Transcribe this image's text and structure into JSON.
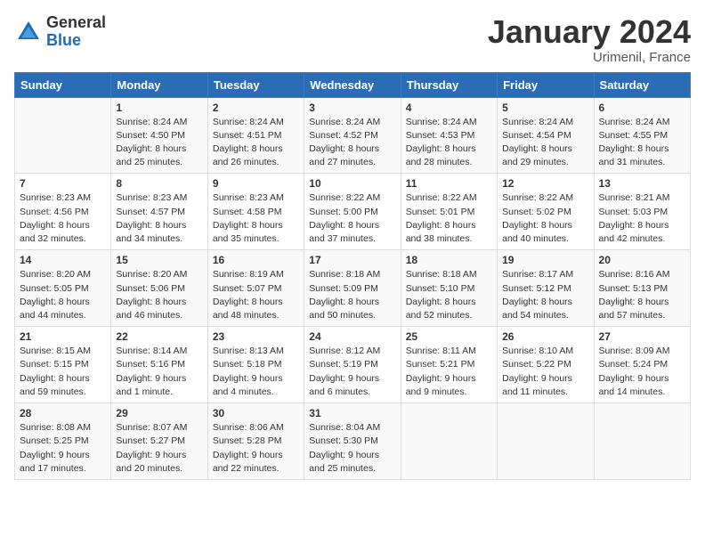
{
  "logo": {
    "general": "General",
    "blue": "Blue"
  },
  "title": "January 2024",
  "location": "Urimenil, France",
  "days_header": [
    "Sunday",
    "Monday",
    "Tuesday",
    "Wednesday",
    "Thursday",
    "Friday",
    "Saturday"
  ],
  "weeks": [
    [
      {
        "day": "",
        "sunrise": "",
        "sunset": "",
        "daylight": ""
      },
      {
        "day": "1",
        "sunrise": "Sunrise: 8:24 AM",
        "sunset": "Sunset: 4:50 PM",
        "daylight": "Daylight: 8 hours and 25 minutes."
      },
      {
        "day": "2",
        "sunrise": "Sunrise: 8:24 AM",
        "sunset": "Sunset: 4:51 PM",
        "daylight": "Daylight: 8 hours and 26 minutes."
      },
      {
        "day": "3",
        "sunrise": "Sunrise: 8:24 AM",
        "sunset": "Sunset: 4:52 PM",
        "daylight": "Daylight: 8 hours and 27 minutes."
      },
      {
        "day": "4",
        "sunrise": "Sunrise: 8:24 AM",
        "sunset": "Sunset: 4:53 PM",
        "daylight": "Daylight: 8 hours and 28 minutes."
      },
      {
        "day": "5",
        "sunrise": "Sunrise: 8:24 AM",
        "sunset": "Sunset: 4:54 PM",
        "daylight": "Daylight: 8 hours and 29 minutes."
      },
      {
        "day": "6",
        "sunrise": "Sunrise: 8:24 AM",
        "sunset": "Sunset: 4:55 PM",
        "daylight": "Daylight: 8 hours and 31 minutes."
      }
    ],
    [
      {
        "day": "7",
        "sunrise": "Sunrise: 8:23 AM",
        "sunset": "Sunset: 4:56 PM",
        "daylight": "Daylight: 8 hours and 32 minutes."
      },
      {
        "day": "8",
        "sunrise": "Sunrise: 8:23 AM",
        "sunset": "Sunset: 4:57 PM",
        "daylight": "Daylight: 8 hours and 34 minutes."
      },
      {
        "day": "9",
        "sunrise": "Sunrise: 8:23 AM",
        "sunset": "Sunset: 4:58 PM",
        "daylight": "Daylight: 8 hours and 35 minutes."
      },
      {
        "day": "10",
        "sunrise": "Sunrise: 8:22 AM",
        "sunset": "Sunset: 5:00 PM",
        "daylight": "Daylight: 8 hours and 37 minutes."
      },
      {
        "day": "11",
        "sunrise": "Sunrise: 8:22 AM",
        "sunset": "Sunset: 5:01 PM",
        "daylight": "Daylight: 8 hours and 38 minutes."
      },
      {
        "day": "12",
        "sunrise": "Sunrise: 8:22 AM",
        "sunset": "Sunset: 5:02 PM",
        "daylight": "Daylight: 8 hours and 40 minutes."
      },
      {
        "day": "13",
        "sunrise": "Sunrise: 8:21 AM",
        "sunset": "Sunset: 5:03 PM",
        "daylight": "Daylight: 8 hours and 42 minutes."
      }
    ],
    [
      {
        "day": "14",
        "sunrise": "Sunrise: 8:20 AM",
        "sunset": "Sunset: 5:05 PM",
        "daylight": "Daylight: 8 hours and 44 minutes."
      },
      {
        "day": "15",
        "sunrise": "Sunrise: 8:20 AM",
        "sunset": "Sunset: 5:06 PM",
        "daylight": "Daylight: 8 hours and 46 minutes."
      },
      {
        "day": "16",
        "sunrise": "Sunrise: 8:19 AM",
        "sunset": "Sunset: 5:07 PM",
        "daylight": "Daylight: 8 hours and 48 minutes."
      },
      {
        "day": "17",
        "sunrise": "Sunrise: 8:18 AM",
        "sunset": "Sunset: 5:09 PM",
        "daylight": "Daylight: 8 hours and 50 minutes."
      },
      {
        "day": "18",
        "sunrise": "Sunrise: 8:18 AM",
        "sunset": "Sunset: 5:10 PM",
        "daylight": "Daylight: 8 hours and 52 minutes."
      },
      {
        "day": "19",
        "sunrise": "Sunrise: 8:17 AM",
        "sunset": "Sunset: 5:12 PM",
        "daylight": "Daylight: 8 hours and 54 minutes."
      },
      {
        "day": "20",
        "sunrise": "Sunrise: 8:16 AM",
        "sunset": "Sunset: 5:13 PM",
        "daylight": "Daylight: 8 hours and 57 minutes."
      }
    ],
    [
      {
        "day": "21",
        "sunrise": "Sunrise: 8:15 AM",
        "sunset": "Sunset: 5:15 PM",
        "daylight": "Daylight: 8 hours and 59 minutes."
      },
      {
        "day": "22",
        "sunrise": "Sunrise: 8:14 AM",
        "sunset": "Sunset: 5:16 PM",
        "daylight": "Daylight: 9 hours and 1 minute."
      },
      {
        "day": "23",
        "sunrise": "Sunrise: 8:13 AM",
        "sunset": "Sunset: 5:18 PM",
        "daylight": "Daylight: 9 hours and 4 minutes."
      },
      {
        "day": "24",
        "sunrise": "Sunrise: 8:12 AM",
        "sunset": "Sunset: 5:19 PM",
        "daylight": "Daylight: 9 hours and 6 minutes."
      },
      {
        "day": "25",
        "sunrise": "Sunrise: 8:11 AM",
        "sunset": "Sunset: 5:21 PM",
        "daylight": "Daylight: 9 hours and 9 minutes."
      },
      {
        "day": "26",
        "sunrise": "Sunrise: 8:10 AM",
        "sunset": "Sunset: 5:22 PM",
        "daylight": "Daylight: 9 hours and 11 minutes."
      },
      {
        "day": "27",
        "sunrise": "Sunrise: 8:09 AM",
        "sunset": "Sunset: 5:24 PM",
        "daylight": "Daylight: 9 hours and 14 minutes."
      }
    ],
    [
      {
        "day": "28",
        "sunrise": "Sunrise: 8:08 AM",
        "sunset": "Sunset: 5:25 PM",
        "daylight": "Daylight: 9 hours and 17 minutes."
      },
      {
        "day": "29",
        "sunrise": "Sunrise: 8:07 AM",
        "sunset": "Sunset: 5:27 PM",
        "daylight": "Daylight: 9 hours and 20 minutes."
      },
      {
        "day": "30",
        "sunrise": "Sunrise: 8:06 AM",
        "sunset": "Sunset: 5:28 PM",
        "daylight": "Daylight: 9 hours and 22 minutes."
      },
      {
        "day": "31",
        "sunrise": "Sunrise: 8:04 AM",
        "sunset": "Sunset: 5:30 PM",
        "daylight": "Daylight: 9 hours and 25 minutes."
      },
      {
        "day": "",
        "sunrise": "",
        "sunset": "",
        "daylight": ""
      },
      {
        "day": "",
        "sunrise": "",
        "sunset": "",
        "daylight": ""
      },
      {
        "day": "",
        "sunrise": "",
        "sunset": "",
        "daylight": ""
      }
    ]
  ]
}
